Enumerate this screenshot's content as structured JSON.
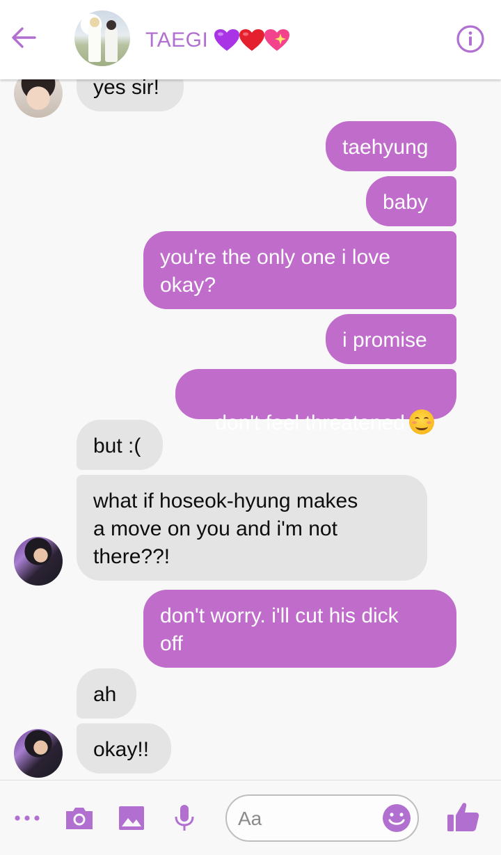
{
  "header": {
    "back_label": "Back",
    "title": "TAEGI",
    "info_label": "Info",
    "heart_colors": [
      "#a834e6",
      "#e5202e",
      "#f2438c"
    ]
  },
  "messages": [
    {
      "from": "other",
      "text": "yes sir!"
    },
    {
      "from": "me",
      "text": "taehyung"
    },
    {
      "from": "me",
      "text": "baby"
    },
    {
      "from": "me",
      "text": "you're the only one i love\nokay?"
    },
    {
      "from": "me",
      "text": "i promise"
    },
    {
      "from": "me",
      "text": "don't feel threatened",
      "emoji": "smiling-face-icon"
    },
    {
      "from": "other",
      "text": "but :("
    },
    {
      "from": "other",
      "text": "what if hoseok-hyung makes\na move on you and i'm not\nthere??!"
    },
    {
      "from": "me",
      "text": "don't worry. i'll cut his dick\noff"
    },
    {
      "from": "other",
      "text": "ah"
    },
    {
      "from": "other",
      "text": "okay!!"
    }
  ],
  "composer": {
    "placeholder": "Aa",
    "icons": [
      "more-icon",
      "camera-icon",
      "image-icon",
      "microphone-icon",
      "emoji-icon",
      "thumbs-up-icon"
    ]
  },
  "colors": {
    "accent": "#bf6ccb",
    "incoming_bubble": "#e4e4e5",
    "title": "#b16fd0"
  }
}
